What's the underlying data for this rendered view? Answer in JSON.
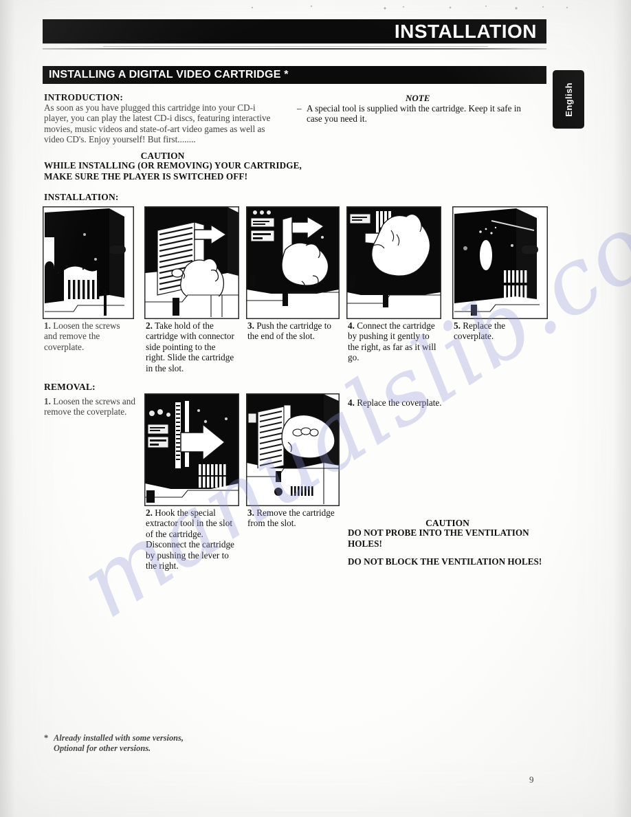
{
  "header": {
    "title": "INSTALLATION",
    "subtitle": "INSTALLING A DIGITAL VIDEO CARTRIDGE *",
    "language_tab": "English"
  },
  "intro": {
    "label": "INTRODUCTION:",
    "body": "As soon as you have plugged this cartridge into your CD-i player, you can play the latest CD-i discs, featuring interactive movies, music videos and state-of-art video games as well as video CD's. Enjoy yourself! But first........"
  },
  "note": {
    "label": "NOTE",
    "dash": "–",
    "body": "A special tool is supplied with the cartridge. Keep it safe in case you need it."
  },
  "caution_top": {
    "title": "CAUTION",
    "body": "WHILE INSTALLING (OR REMOVING) YOUR CARTRIDGE, MAKE SURE THE PLAYER IS SWITCHED OFF!"
  },
  "installation": {
    "label": "INSTALLATION:",
    "steps": [
      {
        "number": "1.",
        "text": "Loosen the screws and remove the coverplate.",
        "figure": "cd-i-player-coverplate-screws"
      },
      {
        "number": "2.",
        "text": "Take hold of the cartridge with connector side pointing to the right. Slide the cartridge in the slot.",
        "figure": "hand-holding-cartridge-arrow-left"
      },
      {
        "number": "3.",
        "text": "Push the cartridge to the end of the slot.",
        "figure": "hand-pushing-cartridge-arrow-left"
      },
      {
        "number": "4.",
        "text": "Connect the cartridge by pushing it gently to the right, as far as it will go.",
        "figure": "hand-connecting-cartridge-arrow-right"
      },
      {
        "number": "5.",
        "text": "Replace the coverplate.",
        "figure": "player-with-coverplate-replaced"
      }
    ]
  },
  "removal": {
    "label": "REMOVAL:",
    "steps": [
      {
        "number": "1.",
        "text": "Loosen the screws and remove the coverplate.",
        "figure": ""
      },
      {
        "number": "2.",
        "text": "Hook the special extractor tool in the slot of the cartridge. Disconnect the cartridge by pushing the lever to the right.",
        "figure": "extractor-tool-arrow-right"
      },
      {
        "number": "3.",
        "text": "Remove the cartridge from the slot.",
        "figure": "hand-removing-cartridge"
      },
      {
        "number": "4.",
        "text": "Replace the coverplate.",
        "figure": ""
      }
    ]
  },
  "caution_bottom": {
    "title": "CAUTION",
    "line1": "DO NOT PROBE INTO THE VENTILATION HOLES!",
    "line2": "DO NOT BLOCK THE VENTILATION HOLES!"
  },
  "footnote": {
    "marker": "*",
    "line1": "Already installed with some versions,",
    "line2": "Optional for other versions."
  },
  "page_number": "9",
  "watermark": "manualslib.com",
  "colors": {
    "bar_black": "#0b0b0b",
    "bar_text": "#ffffff",
    "paper": "#fdfdfb",
    "watermark": "#8f93d6"
  }
}
